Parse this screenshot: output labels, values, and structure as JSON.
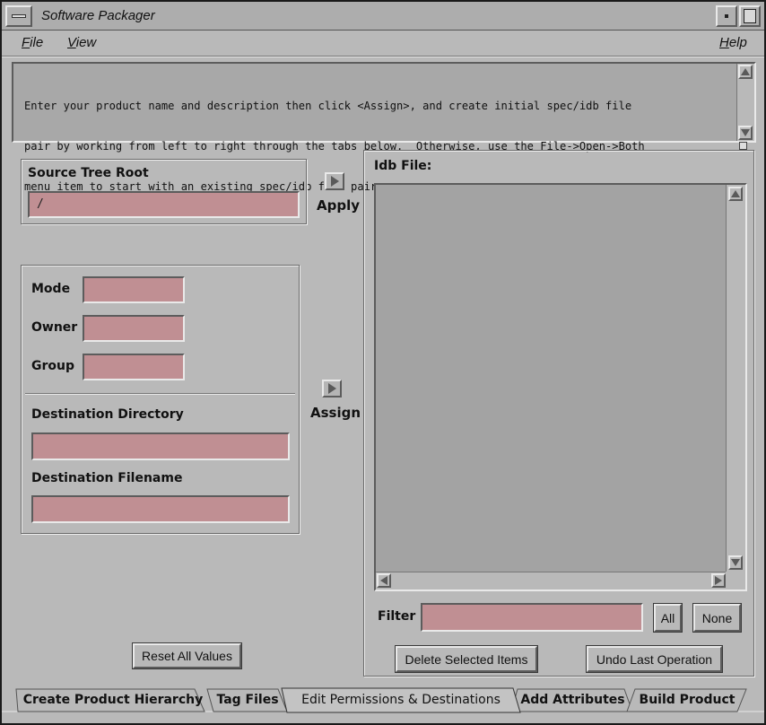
{
  "window": {
    "title": "Software Packager"
  },
  "menubar": {
    "file": {
      "mnemonic": "F",
      "rest": "ile"
    },
    "view": {
      "mnemonic": "V",
      "rest": "iew"
    },
    "help": {
      "mnemonic": "H",
      "rest": "elp"
    }
  },
  "instructions": {
    "line1": "Enter your product name and description then click <Assign>, and create initial spec/idb file",
    "line2": "pair by working from left to right through the tabs below.  Otherwise, use the File->Open->Both",
    "line3": "menu item to start with an existing spec/idb file pair."
  },
  "source_tree": {
    "label": "Source Tree Root",
    "value": "/"
  },
  "apply_label": "Apply",
  "assign_label": "Assign",
  "permissions": {
    "mode_label": "Mode",
    "mode_value": "",
    "owner_label": "Owner",
    "owner_value": "",
    "group_label": "Group",
    "group_value": "",
    "dest_dir_label": "Destination Directory",
    "dest_dir_value": "",
    "dest_file_label": "Destination Filename",
    "dest_file_value": ""
  },
  "reset_label": "Reset All Values",
  "idb": {
    "label": "Idb File:",
    "items": []
  },
  "filter": {
    "label": "Filter",
    "value": "",
    "all_label": "All",
    "none_label": "None"
  },
  "delete_label": "Delete Selected Items",
  "undo_label": "Undo Last Operation",
  "tabs": [
    {
      "label": "Create Product Hierarchy",
      "active": false
    },
    {
      "label": "Tag Files",
      "active": false
    },
    {
      "label": "Edit Permissions & Destinations",
      "active": true
    },
    {
      "label": "Add Attributes",
      "active": false
    },
    {
      "label": "Build Product",
      "active": false
    }
  ],
  "colors": {
    "window_bg": "#b9b9b9",
    "field_bg": "#c08f93",
    "list_bg": "#a3a3a3",
    "text_area_bg": "#a8a8a8"
  },
  "icons": [
    "window-menu-icon",
    "minimize-icon",
    "maximize-icon",
    "apply-arrow-icon",
    "assign-arrow-icon",
    "scroll-up-icon",
    "scroll-down-icon",
    "scroll-left-icon",
    "scroll-right-icon",
    "resize-grip-icon"
  ]
}
